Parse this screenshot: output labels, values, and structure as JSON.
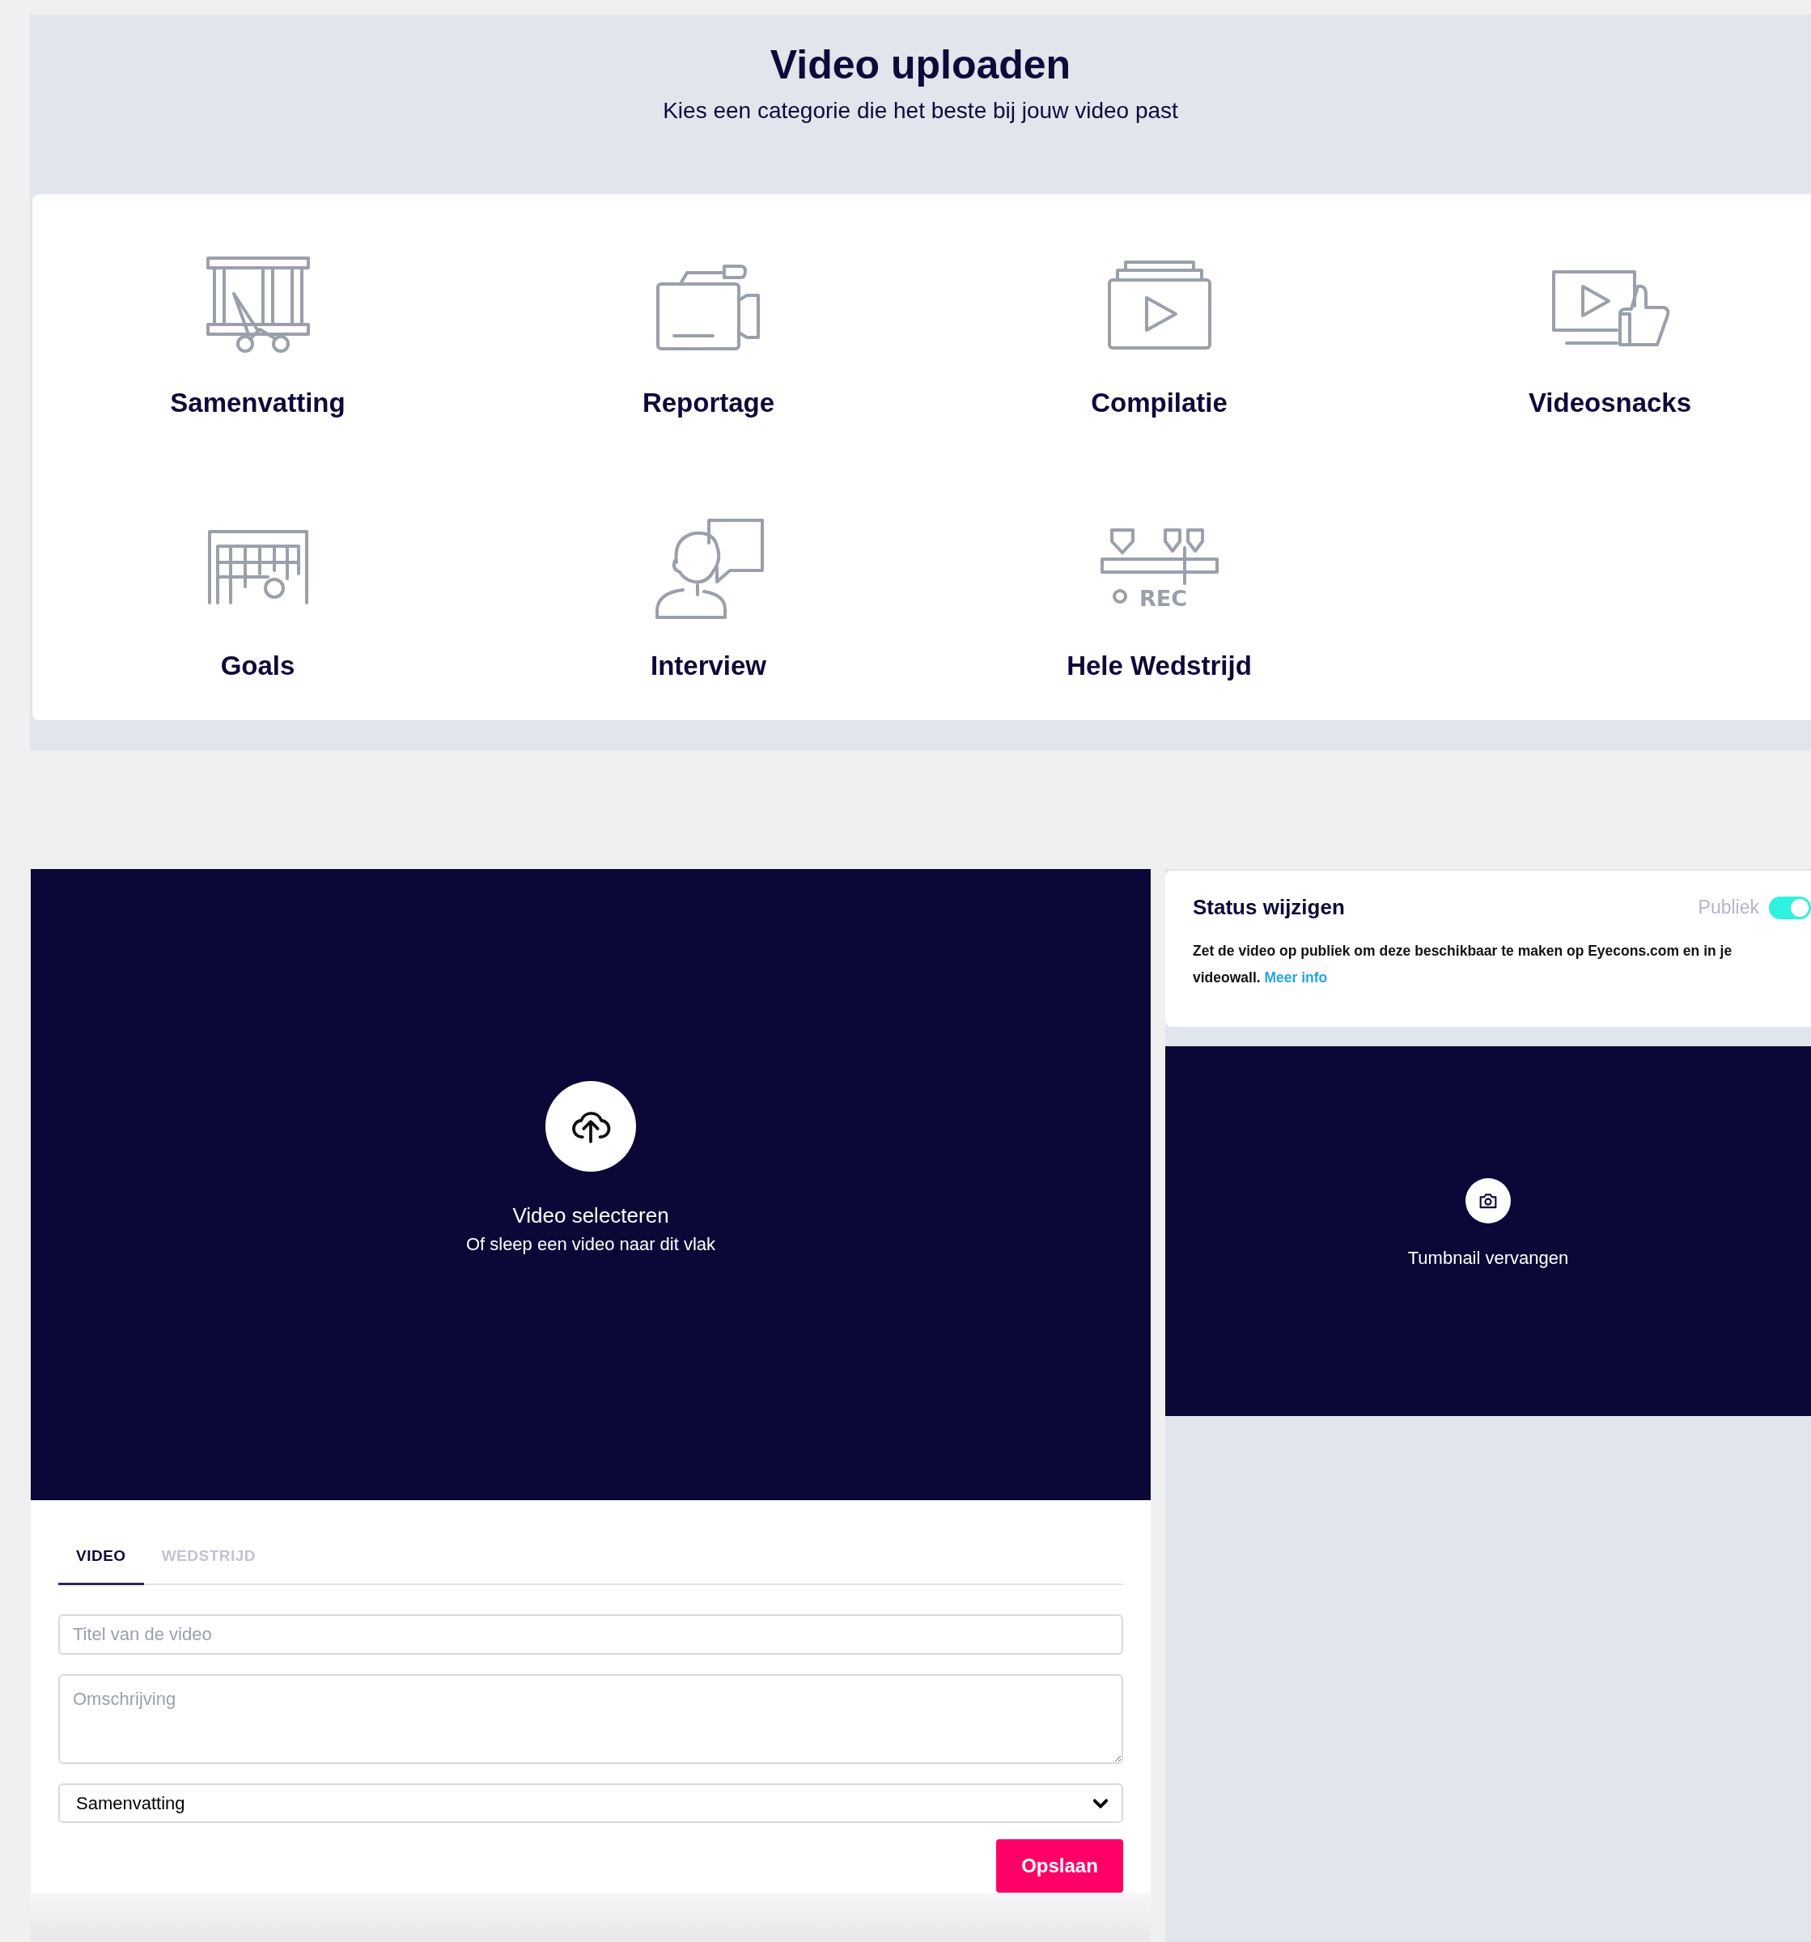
{
  "header": {
    "title": "Video uploaden",
    "subtitle": "Kies een categorie die het beste bij jouw video past"
  },
  "categories": [
    {
      "label": "Samenvatting",
      "kind": "cut"
    },
    {
      "label": "Reportage",
      "kind": "camera"
    },
    {
      "label": "Compilatie",
      "kind": "stack"
    },
    {
      "label": "Videosnacks",
      "kind": "thumb"
    },
    {
      "label": "Goals",
      "kind": "goal"
    },
    {
      "label": "Interview",
      "kind": "interview"
    },
    {
      "label": "Hele Wedstrijd",
      "kind": "rec",
      "icon_text": "REC"
    }
  ],
  "upload": {
    "title": "Video selecteren",
    "hint": "Of sleep een video naar dit vlak"
  },
  "tabs": [
    {
      "label": "VIDEO",
      "selected": true
    },
    {
      "label": "WEDSTRIJD",
      "selected": false
    }
  ],
  "form": {
    "title_field": {
      "placeholder": "Titel van de video"
    },
    "description_field": {
      "placeholder": "Omschrijving"
    },
    "category_select": {
      "value": "Samenvatting"
    },
    "save_button": "Opslaan"
  },
  "status": {
    "title": "Status wijzigen",
    "toggle_label": "Publiek",
    "on": true,
    "text": "Zet de video op publiek om deze beschikbaar te maken op Eyecons.com en in je videowall.",
    "link": "Meer info"
  },
  "thumbnail": {
    "label": "Tumbnail vervangen"
  }
}
